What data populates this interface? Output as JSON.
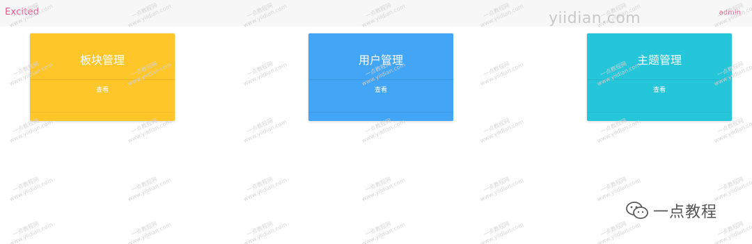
{
  "header": {
    "brand": "Excited",
    "user": "admin",
    "site_logo": "yiidian.com"
  },
  "cards": [
    {
      "title": "板块管理",
      "action": "查看",
      "color": "#ffc62a"
    },
    {
      "title": "用户管理",
      "action": "查看",
      "color": "#42a5f5"
    },
    {
      "title": "主题管理",
      "action": "查看",
      "color": "#26c6da"
    }
  ],
  "watermark": {
    "cn": "一点教程网",
    "url": "www.yiidian.com"
  },
  "footer_mark": {
    "icon": "wechat-icon",
    "text": "一点教程"
  }
}
